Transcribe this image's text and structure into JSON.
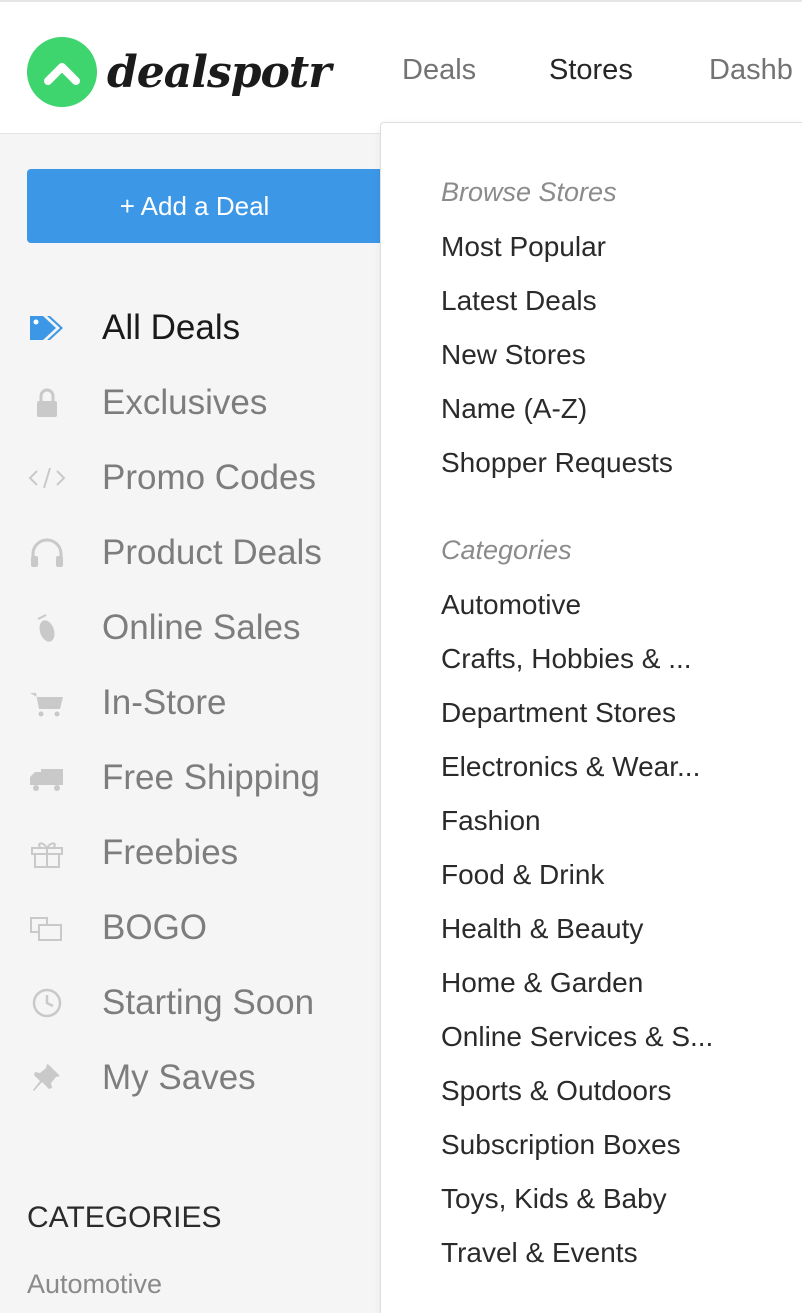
{
  "brand": {
    "name": "dealspotr"
  },
  "nav": {
    "deals": "Deals",
    "stores": "Stores",
    "dashboard": "Dashb"
  },
  "sidebar": {
    "add_deal": "+ Add a Deal",
    "items": [
      {
        "label": "All Deals",
        "icon": "tag-icon",
        "active": true
      },
      {
        "label": "Exclusives",
        "icon": "lock-icon"
      },
      {
        "label": "Promo Codes",
        "icon": "code-icon"
      },
      {
        "label": "Product Deals",
        "icon": "headphones-icon"
      },
      {
        "label": "Online Sales",
        "icon": "mouse-icon"
      },
      {
        "label": "In-Store",
        "icon": "cart-icon"
      },
      {
        "label": "Free Shipping",
        "icon": "truck-icon"
      },
      {
        "label": "Freebies",
        "icon": "gift-icon"
      },
      {
        "label": "BOGO",
        "icon": "copy-icon"
      },
      {
        "label": "Starting Soon",
        "icon": "clock-icon"
      },
      {
        "label": "My Saves",
        "icon": "pin-icon"
      }
    ],
    "categories_heading": "CATEGORIES",
    "categories_first": "Automotive"
  },
  "dropdown": {
    "browse_heading": "Browse Stores",
    "browse": [
      "Most Popular",
      "Latest Deals",
      "New Stores",
      "Name (A-Z)",
      "Shopper Requests"
    ],
    "categories_heading": "Categories",
    "categories": [
      "Automotive",
      "Crafts, Hobbies & ...",
      "Department Stores",
      "Electronics & Wear...",
      "Fashion",
      "Food & Drink",
      "Health & Beauty",
      "Home & Garden",
      "Online Services & S...",
      "Sports & Outdoors",
      "Subscription Boxes",
      "Toys, Kids & Baby",
      "Travel & Events"
    ]
  },
  "colors": {
    "brand_green": "#3ed46e",
    "button_blue": "#3c97e6",
    "active_icon_blue": "#3c97e6"
  }
}
